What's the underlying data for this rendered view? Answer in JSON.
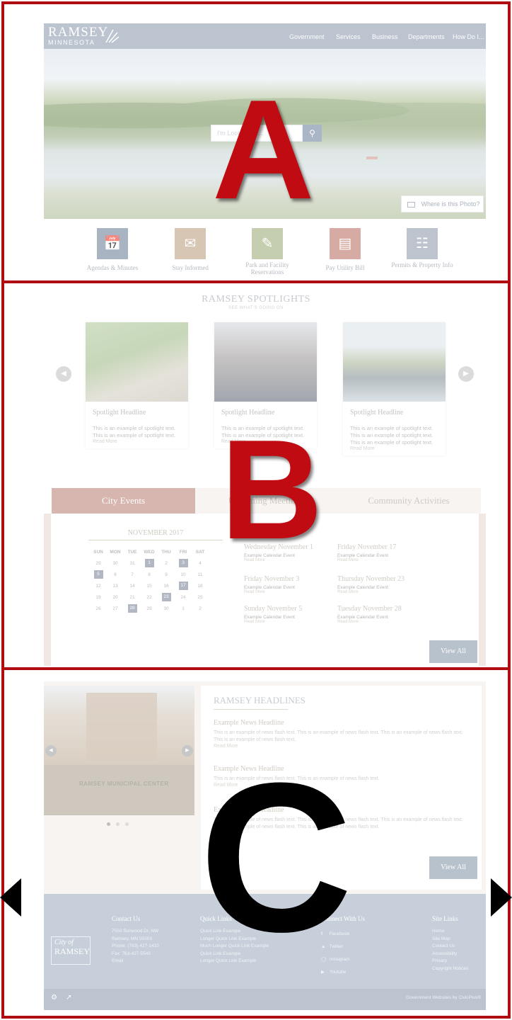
{
  "section_labels": {
    "a": "A",
    "b": "B",
    "c": "C"
  },
  "header": {
    "logo_line1": "RAMSEY",
    "logo_line2": "MINNESOTA",
    "nav": [
      "Government",
      "Services",
      "Business",
      "Departments",
      "How Do I..."
    ]
  },
  "search": {
    "placeholder": "I'm Looking for..."
  },
  "hero": {
    "photo_button": "Where is this Photo?"
  },
  "quick_links": [
    {
      "label": "Agendas & Minutes",
      "color": "#7b8ca3",
      "icon": "calendar-icon"
    },
    {
      "label": "Stay Informed",
      "color": "#c2a88c",
      "icon": "envelope-icon"
    },
    {
      "label": "Park and Facility Reservations",
      "color": "#a8b486",
      "icon": "edit-icon"
    },
    {
      "label": "Pay Utility Bill",
      "color": "#c07e72",
      "icon": "payment-icon"
    },
    {
      "label": "Permits & Property Info",
      "color": "#9aa5b4",
      "icon": "document-icon"
    }
  ],
  "spotlights": {
    "title": "RAMSEY SPOTLIGHTS",
    "subtitle": "SEE WHAT'S GOING ON",
    "cards": [
      {
        "headline": "Spotlight Headline",
        "text": "This is an example of spotlight text. This is an example of spotlight text.",
        "read_more": "Read More"
      },
      {
        "headline": "Spotlight Headline",
        "text": "This is an example of spotlight text. This is an example of spotlight text.",
        "read_more": "Read More"
      },
      {
        "headline": "Spotlight Headline",
        "text": "This is an example of spotlight text. This is an example of spotlight text. This is an example of spotlight text.",
        "read_more": "Read More"
      }
    ]
  },
  "tabs": [
    "City Events",
    "Upcoming Meetings",
    "Community Activities"
  ],
  "calendar": {
    "month": "NOVEMBER 2017",
    "days": [
      "SUN",
      "MON",
      "TUE",
      "WED",
      "THU",
      "FRI",
      "SAT"
    ],
    "weeks": [
      [
        "29",
        "30",
        "31",
        "1",
        "2",
        "3",
        "4"
      ],
      [
        "5",
        "6",
        "7",
        "8",
        "9",
        "10",
        "11"
      ],
      [
        "12",
        "13",
        "14",
        "15",
        "16",
        "17",
        "18"
      ],
      [
        "19",
        "20",
        "21",
        "22",
        "23",
        "24",
        "25"
      ],
      [
        "26",
        "27",
        "28",
        "29",
        "30",
        "1",
        "2"
      ]
    ]
  },
  "events": [
    {
      "date": "Wednesday November 1",
      "name": "Example Calendar Event",
      "read_more": "Read More"
    },
    {
      "date": "Friday November 17",
      "name": "Example Calendar Event",
      "read_more": "Read More"
    },
    {
      "date": "Friday November 3",
      "name": "Example Calendar Event",
      "read_more": "Read More"
    },
    {
      "date": "Thursday November 23",
      "name": "Example Calendar Event",
      "read_more": "Read More"
    },
    {
      "date": "Sunday November 5",
      "name": "Example Calendar Event",
      "read_more": "Read More"
    },
    {
      "date": "Tuesday November 28",
      "name": "Example Calendar Event",
      "read_more": "Read More"
    }
  ],
  "view_all": "View All",
  "building_sign": "RAMSEY MUNICIPAL CENTER",
  "headlines": {
    "title": "RAMSEY HEADLINES",
    "items": [
      {
        "headline": "Example News Headline",
        "text": "This is an example of news flash text. This is an example of news flash text. This is an example of news flash text. This is an example of news flash text.",
        "read_more": "Read More"
      },
      {
        "headline": "Example News Headline",
        "text": "This is an example of news flash text. This is an example of news flash text.",
        "read_more": "Read More"
      },
      {
        "headline": "Example News Headline",
        "text": "This is an example of news flash text. This is an example of news flash text. This is an example of news flash text. This is an example of news flash text. This is an example of news flash text.",
        "read_more": "Read More"
      }
    ]
  },
  "footer": {
    "logo_line1": "City of",
    "logo_line2": "RAMSEY",
    "contact": {
      "title": "Contact Us",
      "lines": [
        "7550 Sunwood Dr. NW",
        "Ramsey, MN 55303",
        "Phone: (763) 427-1410",
        "Fax: 763-427-5543",
        "Email"
      ]
    },
    "quick_links": {
      "title": "Quick Links",
      "lines": [
        "Quick Link Example",
        "Longer Quick Link Example",
        "Much Longer Quick Link Example",
        "Quick Link Example",
        "Longer Quick Link Example"
      ]
    },
    "connect": {
      "title": "Connect With Us",
      "lines": [
        "Facebook",
        "Twitter",
        "Instagram",
        "Youtube"
      ]
    },
    "site_links": {
      "title": "Site Links",
      "lines": [
        "Home",
        "Site Map",
        "Contact Us",
        "Accessibility",
        "Privacy",
        "Copyright Notices"
      ]
    },
    "credit": "Government Websites by CivicPlus®"
  },
  "colors": {
    "frame": "#b00d12",
    "tab_active": "#c08f85",
    "button": "#93a1b2",
    "footer": "#a8b6c6"
  }
}
